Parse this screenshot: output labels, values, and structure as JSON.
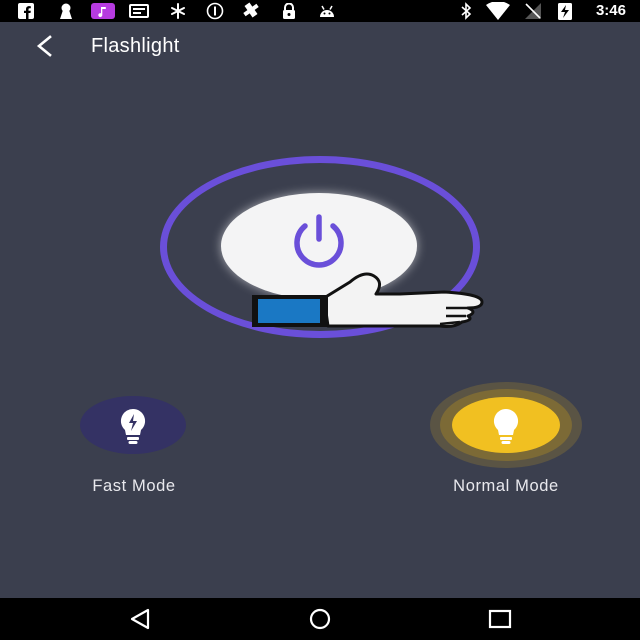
{
  "status_bar": {
    "clock": "3:46",
    "left_icons": [
      "facebook-icon",
      "keyhole-icon",
      "music-app-icon",
      "tray-icon",
      "fan-icon",
      "info-circle-icon",
      "satellite-icon",
      "lock-icon",
      "android-icon"
    ],
    "right_icons": [
      "bluetooth-icon",
      "wifi-icon",
      "no-signal-icon",
      "battery-charging-icon"
    ]
  },
  "app_bar": {
    "title": "Flashlight",
    "back_icon": "chevron-left-icon"
  },
  "power": {
    "icon": "power-icon",
    "accent_color": "#6a4fd9",
    "pointer_icon": "thumbs-up-pointer-icon"
  },
  "modes": {
    "fast": {
      "label": "Fast Mode",
      "icon": "bulb-fast-icon",
      "color": "#343264"
    },
    "normal": {
      "label": "Normal Mode",
      "icon": "bulb-icon",
      "color": "#f1c021",
      "selected": true
    }
  },
  "nav_bar": {
    "back_icon": "triangle-back-icon",
    "home_icon": "circle-home-icon",
    "recents_icon": "square-recents-icon"
  },
  "colors": {
    "background": "#3b3f4e",
    "status_bar": "#000000"
  }
}
